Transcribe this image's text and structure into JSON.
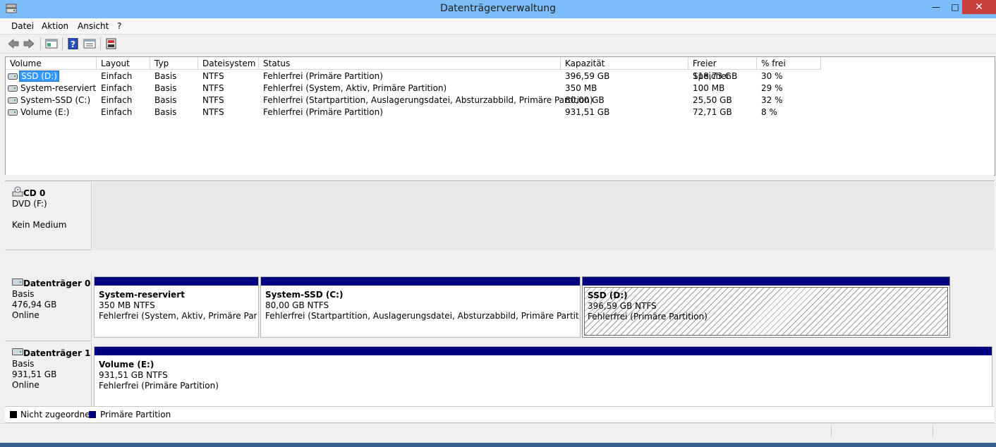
{
  "window": {
    "title": "Datenträgerverwaltung"
  },
  "menu": [
    "Datei",
    "Aktion",
    "Ansicht",
    "?"
  ],
  "toolbar_icons": [
    "back-arrow-icon",
    "forward-arrow-icon",
    "console-tree-icon",
    "help-icon",
    "properties-icon",
    "disk-settings-icon"
  ],
  "columns": [
    "Volume",
    "Layout",
    "Typ",
    "Dateisystem",
    "Status",
    "Kapazität",
    "Freier Speicher",
    "% frei"
  ],
  "volumes": [
    {
      "name": "SSD (D:)",
      "layout": "Einfach",
      "type": "Basis",
      "fs": "NTFS",
      "status": "Fehlerfrei (Primäre Partition)",
      "capacity": "396,59 GB",
      "free": "118,73 GB",
      "pct": "30 %"
    },
    {
      "name": "System-reserviert",
      "layout": "Einfach",
      "type": "Basis",
      "fs": "NTFS",
      "status": "Fehlerfrei (System, Aktiv, Primäre Partition)",
      "capacity": "350 MB",
      "free": "100 MB",
      "pct": "29 %"
    },
    {
      "name": "System-SSD (C:)",
      "layout": "Einfach",
      "type": "Basis",
      "fs": "NTFS",
      "status": "Fehlerfrei (Startpartition, Auslagerungsdatei, Absturzabbild, Primäre Partition)",
      "capacity": "80,00 GB",
      "free": "25,50 GB",
      "pct": "32 %"
    },
    {
      "name": "Volume (E:)",
      "layout": "Einfach",
      "type": "Basis",
      "fs": "NTFS",
      "status": "Fehlerfrei (Primäre Partition)",
      "capacity": "931,51 GB",
      "free": "72,71 GB",
      "pct": "8 %"
    }
  ],
  "disks": [
    {
      "name": "CD 0",
      "lines": [
        "DVD (F:)",
        "",
        "Kein Medium"
      ]
    },
    {
      "name": "Datenträger 0",
      "lines": [
        "Basis",
        "476,94 GB",
        "Online"
      ]
    },
    {
      "name": "Datenträger 1",
      "lines": [
        "Basis",
        "931,51 GB",
        "Online"
      ]
    }
  ],
  "disk0_partitions": [
    {
      "name": "System-reserviert",
      "size": "350 MB NTFS",
      "status": "Fehlerfrei (System, Aktiv, Primäre Partition)"
    },
    {
      "name": "System-SSD  (C:)",
      "size": "80,00 GB NTFS",
      "status": "Fehlerfrei (Startpartition, Auslagerungsdatei, Absturzabbild, Primäre Partition)"
    },
    {
      "name": "SSD  (D:)",
      "size": "396,59 GB NTFS",
      "status": "Fehlerfrei (Primäre Partition)"
    }
  ],
  "disk1_partitions": [
    {
      "name": "Volume  (E:)",
      "size": "931,51 GB NTFS",
      "status": "Fehlerfrei (Primäre Partition)"
    }
  ],
  "legend": [
    {
      "label": "Nicht zugeordnet",
      "color": "#000000"
    },
    {
      "label": "Primäre Partition",
      "color": "#00007f"
    }
  ],
  "colors": {
    "primary_partition": "#00007f",
    "selection": "#3399ff",
    "title_bar": "#7bbdf8",
    "close_button": "#c7403b"
  }
}
